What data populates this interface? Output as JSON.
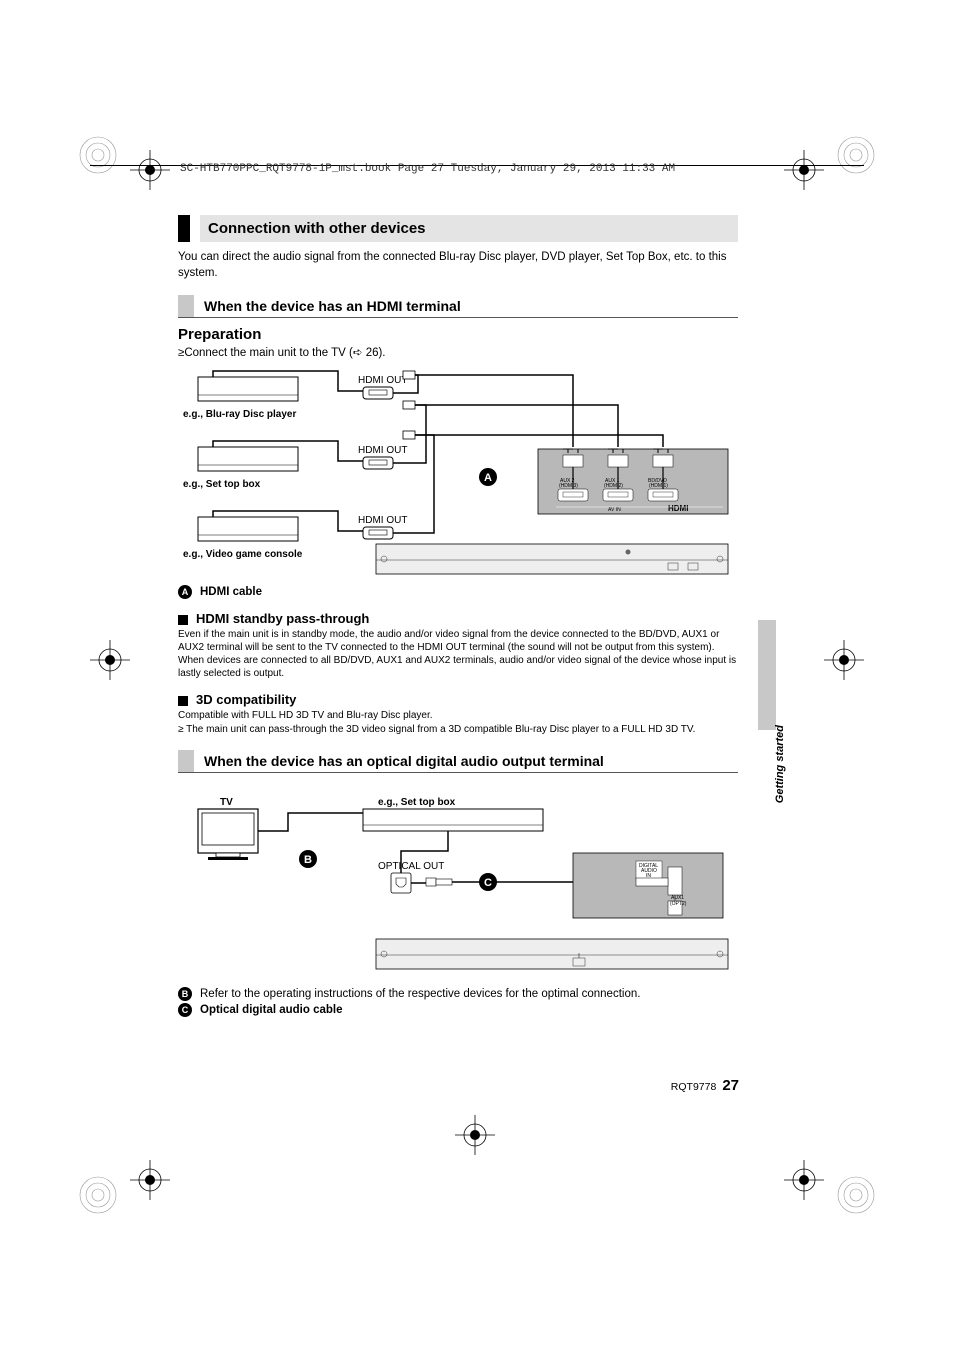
{
  "header": "SC-HTB770PPC_RQT9778-1P_mst.book  Page 27  Tuesday, January 29, 2013  11:33 AM",
  "section_title": "Connection with other devices",
  "intro": "You can direct the audio signal from the connected Blu-ray Disc player, DVD player, Set Top Box, etc. to this system.",
  "sub1_title": "When the device has an HDMI terminal",
  "prep_heading": "Preparation",
  "prep_bullet": "Connect the main unit to the TV (➪ 26).",
  "diagram1": {
    "dev1": "e.g., Blu-ray Disc player",
    "dev2": "e.g., Set top box",
    "dev3": "e.g., Video game console",
    "port1": "HDMI OUT",
    "port2": "HDMI OUT",
    "port3": "HDMI OUT",
    "in_aux2": "AUX 2\n(HDMI3)",
    "in_aux1": "AUX 1\n(HDMI2)",
    "in_bddvd": "BD/DVD\n(HDMI1)",
    "av_in": "AV IN",
    "hdmi": "HDMI",
    "letter": "A"
  },
  "callout_a": "HDMI cable",
  "passthrough_title": "HDMI standby pass-through",
  "passthrough_body": "Even if the main unit is in standby mode, the audio and/or video signal from the device connected to the BD/DVD, AUX1 or AUX2 terminal will be sent to the TV connected to the HDMI OUT terminal (the sound will not be output from this system). When devices are connected to all BD/DVD, AUX1 and AUX2 terminals, audio and/or video signal of the device whose input is lastly selected is output.",
  "compat_title": "3D compatibility",
  "compat_line1": "Compatible with FULL HD 3D TV and Blu-ray Disc player.",
  "compat_line2": "The main unit can pass-through the 3D video signal from a 3D compatible Blu-ray Disc player to a FULL HD 3D TV.",
  "sub2_title": "When the device has an optical digital audio output terminal",
  "diagram2": {
    "tv": "TV",
    "dev": "e.g., Set top box",
    "opt_out": "OPTICAL OUT",
    "digital_in": "DIGITAL\nAUDIO\nIN",
    "aux1_opt": "AUX1\n(OPT2)",
    "letter_b": "B",
    "letter_c": "C"
  },
  "callout_b": "Refer to the operating instructions of the respective devices for the optimal connection.",
  "callout_c": "Optical digital audio cable",
  "side_tab": "Getting started",
  "footer_code": "RQT9778",
  "footer_page": "27"
}
